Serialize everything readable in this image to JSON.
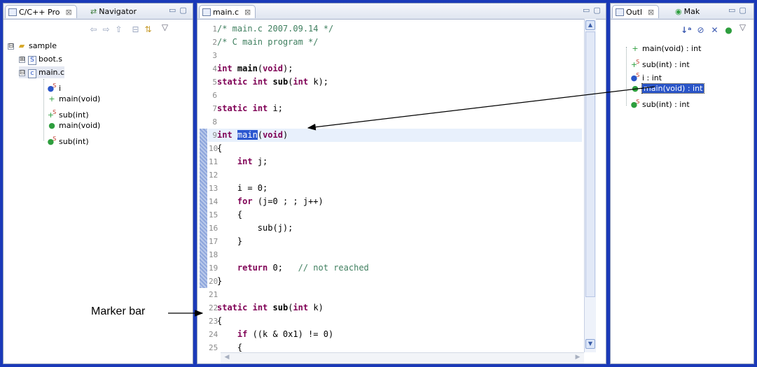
{
  "left_pane": {
    "tabs": [
      {
        "label": "C/C++ Pro",
        "close": "⊠"
      },
      {
        "label": "Navigator"
      }
    ],
    "tree": [
      {
        "label": "sample",
        "icon": "project-folder-icon",
        "toggle": "⊟"
      },
      {
        "label": "boot.s",
        "icon": "asm-file-icon",
        "toggle": "⊞"
      },
      {
        "label": "main.c",
        "icon": "c-file-icon",
        "toggle": "⊟"
      },
      {
        "label": "i",
        "icon": "static-variable-icon"
      },
      {
        "label": "main(void)",
        "icon": "function-declaration-icon"
      },
      {
        "label": "sub(int)",
        "icon": "static-function-declaration-icon"
      },
      {
        "label": "main(void)",
        "icon": "function-icon"
      },
      {
        "label": "sub(int)",
        "icon": "static-function-icon"
      }
    ]
  },
  "editor": {
    "tab_label": "main.c",
    "tab_close": "⊠",
    "lines": [
      {
        "n": "1",
        "text": "/* main.c 2007.09.14 */"
      },
      {
        "n": "2",
        "text": "/* C main program */"
      },
      {
        "n": "3",
        "text": ""
      },
      {
        "n": "4",
        "text": "int main(void);"
      },
      {
        "n": "5",
        "text": "static int sub(int k);"
      },
      {
        "n": "6",
        "text": ""
      },
      {
        "n": "7",
        "text": "static int i;"
      },
      {
        "n": "8",
        "text": ""
      },
      {
        "n": "9",
        "text": "int main(void)"
      },
      {
        "n": "10",
        "text": "{"
      },
      {
        "n": "11",
        "text": "    int j;"
      },
      {
        "n": "12",
        "text": ""
      },
      {
        "n": "13",
        "text": "    i = 0;"
      },
      {
        "n": "14",
        "text": "    for (j=0 ; ; j++)"
      },
      {
        "n": "15",
        "text": "    {"
      },
      {
        "n": "16",
        "text": "        sub(j);"
      },
      {
        "n": "17",
        "text": "    }"
      },
      {
        "n": "18",
        "text": ""
      },
      {
        "n": "19",
        "text": "    return 0;   // not reached"
      },
      {
        "n": "20",
        "text": "}"
      },
      {
        "n": "21",
        "text": ""
      },
      {
        "n": "22",
        "text": "static int sub(int k)"
      },
      {
        "n": "23",
        "text": "{"
      },
      {
        "n": "24",
        "text": "    if ((k & 0x1) != 0)"
      },
      {
        "n": "25",
        "text": "    {"
      }
    ],
    "highlighted_word": "main"
  },
  "outline_pane": {
    "tabs": [
      {
        "label": "Outl",
        "close": "⊠"
      },
      {
        "label": "Mak"
      }
    ],
    "items": [
      {
        "label": "main(void) : int",
        "icon": "function-declaration-icon"
      },
      {
        "label": "sub(int) : int",
        "icon": "static-function-declaration-icon"
      },
      {
        "label": "i : int",
        "icon": "static-variable-icon"
      },
      {
        "label": "main(void) : int",
        "icon": "function-icon",
        "selected": true
      },
      {
        "label": "sub(int) : int",
        "icon": "static-function-icon"
      }
    ]
  },
  "annotation": {
    "marker_bar_label": "Marker bar"
  },
  "colors": {
    "frame": "#1a39b8",
    "keyword": "#7f0055",
    "comment": "#3f7f5f",
    "selection": "#2a55c8",
    "current_line": "#e8f0fc"
  }
}
